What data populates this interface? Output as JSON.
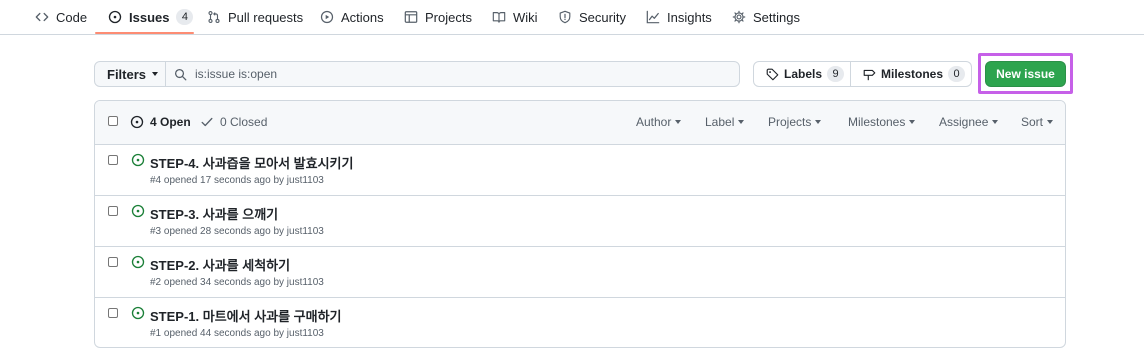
{
  "nav": {
    "items": [
      {
        "label": "Code",
        "icon": "code-icon"
      },
      {
        "label": "Issues",
        "icon": "issue-opened-icon",
        "count": "4",
        "selected": true
      },
      {
        "label": "Pull requests",
        "icon": "git-pull-request-icon"
      },
      {
        "label": "Actions",
        "icon": "play-icon"
      },
      {
        "label": "Projects",
        "icon": "table-icon"
      },
      {
        "label": "Wiki",
        "icon": "book-icon"
      },
      {
        "label": "Security",
        "icon": "shield-icon"
      },
      {
        "label": "Insights",
        "icon": "graph-icon"
      },
      {
        "label": "Settings",
        "icon": "gear-icon"
      }
    ],
    "accent_color": "#fd8c73"
  },
  "subnav": {
    "filters_label": "Filters",
    "search_value": "is:issue is:open",
    "labels_label": "Labels",
    "labels_count": "9",
    "milestones_label": "Milestones",
    "milestones_count": "0",
    "new_issue_label": "New issue",
    "new_issue_color": "#2da44e",
    "highlight_color": "#c660e8"
  },
  "header": {
    "open_label": "4 Open",
    "closed_label": "0 Closed",
    "filters": [
      "Author",
      "Label",
      "Projects",
      "Milestones",
      "Assignee",
      "Sort"
    ]
  },
  "issues": [
    {
      "title": "STEP-4. 사과즙을 모아서 발효시키기",
      "meta": "#4 opened 17 seconds ago by ",
      "author": "just1103"
    },
    {
      "title": "STEP-3. 사과를 으깨기",
      "meta": "#3 opened 28 seconds ago by ",
      "author": "just1103"
    },
    {
      "title": "STEP-2. 사과를 세척하기",
      "meta": "#2 opened 34 seconds ago by ",
      "author": "just1103"
    },
    {
      "title": "STEP-1. 마트에서 사과를 구매하기",
      "meta": "#1 opened 44 seconds ago by ",
      "author": "just1103"
    }
  ],
  "colors": {
    "open_icon": "#1a7f37",
    "border": "#d0d7de",
    "muted_text": "#57606a"
  }
}
